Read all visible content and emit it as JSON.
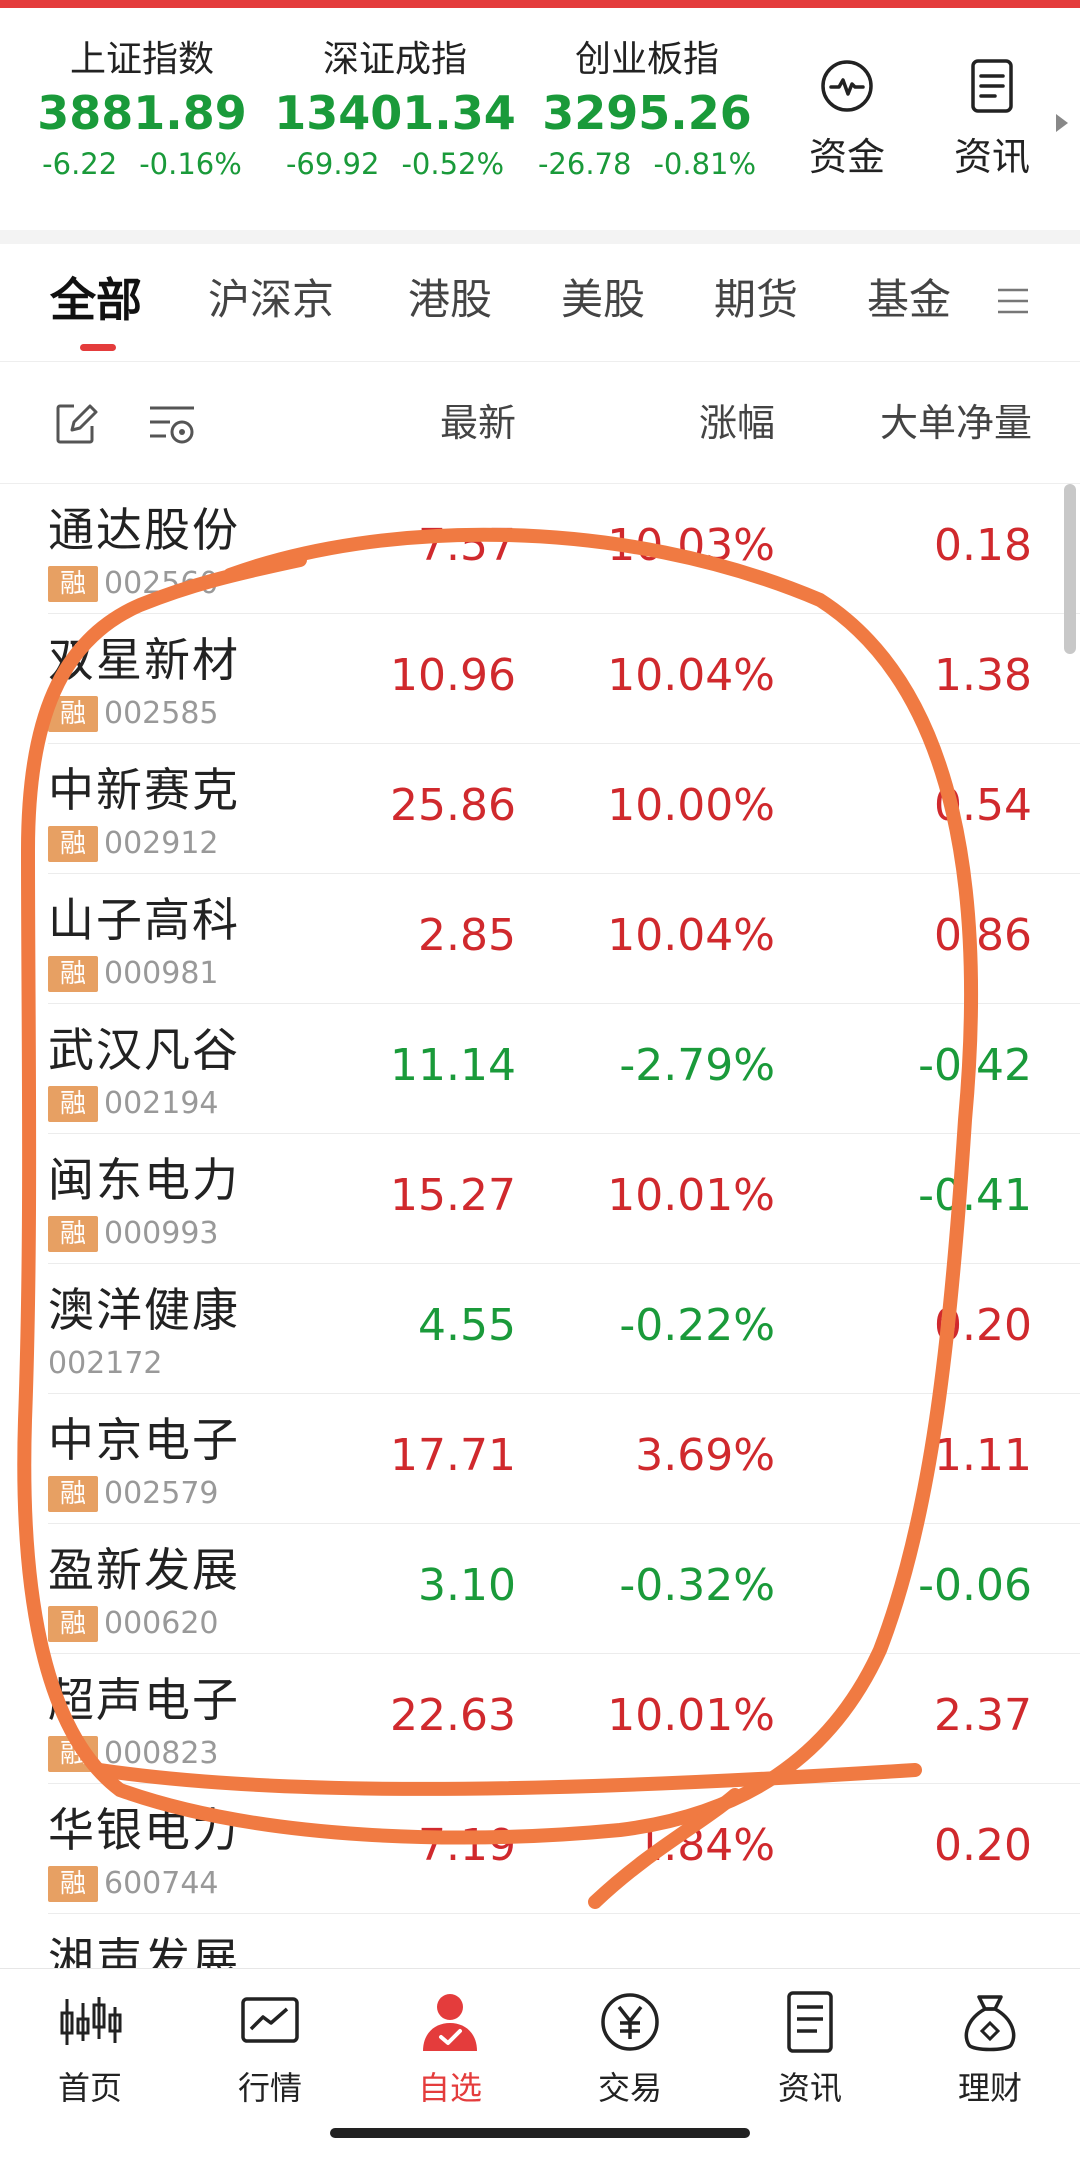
{
  "indices": [
    {
      "name": "上证指数",
      "value": "3881.89",
      "change": "-6.22",
      "pct": "-0.16%"
    },
    {
      "name": "深证成指",
      "value": "13401.34",
      "change": "-69.92",
      "pct": "-0.52%"
    },
    {
      "name": "创业板指",
      "value": "3295.26",
      "change": "-26.78",
      "pct": "-0.81%"
    }
  ],
  "quick_links": [
    {
      "label": "资金",
      "icon": "pulse-icon"
    },
    {
      "label": "资讯",
      "icon": "document-icon"
    }
  ],
  "tabs": [
    {
      "label": "全部",
      "active": true
    },
    {
      "label": "沪深京"
    },
    {
      "label": "港股"
    },
    {
      "label": "美股"
    },
    {
      "label": "期货"
    },
    {
      "label": "基金"
    }
  ],
  "columns": {
    "latest": "最新",
    "pct": "涨幅",
    "big_order": "大单净量"
  },
  "margin_badge": "融",
  "colors": {
    "up": "#d0292d",
    "down": "#1a9a3a",
    "accent": "#e43c3c",
    "badge": "#e7a063",
    "annotation": "#f07a42"
  },
  "stocks": [
    {
      "name": "通达股份",
      "code": "002560",
      "margin": true,
      "price": "7.57",
      "pct": "10.03%",
      "net": "0.18",
      "trend": "up"
    },
    {
      "name": "双星新材",
      "code": "002585",
      "margin": true,
      "price": "10.96",
      "pct": "10.04%",
      "net": "1.38",
      "trend": "up"
    },
    {
      "name": "中新赛克",
      "code": "002912",
      "margin": true,
      "price": "25.86",
      "pct": "10.00%",
      "net": "0.54",
      "trend": "up"
    },
    {
      "name": "山子高科",
      "code": "000981",
      "margin": true,
      "price": "2.85",
      "pct": "10.04%",
      "net": "0.86",
      "trend": "up"
    },
    {
      "name": "武汉凡谷",
      "code": "002194",
      "margin": true,
      "price": "11.14",
      "pct": "-2.79%",
      "net": "-0.42",
      "trend": "down"
    },
    {
      "name": "闽东电力",
      "code": "000993",
      "margin": true,
      "price": "15.27",
      "pct": "10.01%",
      "net": "-0.41",
      "trend": "up",
      "net_trend": "down"
    },
    {
      "name": "澳洋健康",
      "code": "002172",
      "margin": false,
      "price": "4.55",
      "pct": "-0.22%",
      "net": "0.20",
      "trend": "down",
      "net_trend": "up"
    },
    {
      "name": "中京电子",
      "code": "002579",
      "margin": true,
      "price": "17.71",
      "pct": "3.69%",
      "net": "1.11",
      "trend": "up"
    },
    {
      "name": "盈新发展",
      "code": "000620",
      "margin": true,
      "price": "3.10",
      "pct": "-0.32%",
      "net": "-0.06",
      "trend": "down"
    },
    {
      "name": "超声电子",
      "code": "000823",
      "margin": true,
      "price": "22.63",
      "pct": "10.01%",
      "net": "2.37",
      "trend": "up"
    },
    {
      "name": "华银电力",
      "code": "600744",
      "margin": true,
      "price": "7.19",
      "pct": "1.84%",
      "net": "0.20",
      "trend": "up"
    },
    {
      "name": "湘声发展",
      "code": "",
      "margin": false,
      "price": "",
      "pct": "",
      "net": "",
      "trend": "up"
    }
  ],
  "bottom_nav": [
    {
      "label": "首页",
      "icon": "candlestick-icon"
    },
    {
      "label": "行情",
      "icon": "chart-icon"
    },
    {
      "label": "自选",
      "icon": "user-check-icon",
      "active": true
    },
    {
      "label": "交易",
      "icon": "yen-icon"
    },
    {
      "label": "资讯",
      "icon": "news-icon"
    },
    {
      "label": "理财",
      "icon": "money-bag-icon"
    }
  ]
}
